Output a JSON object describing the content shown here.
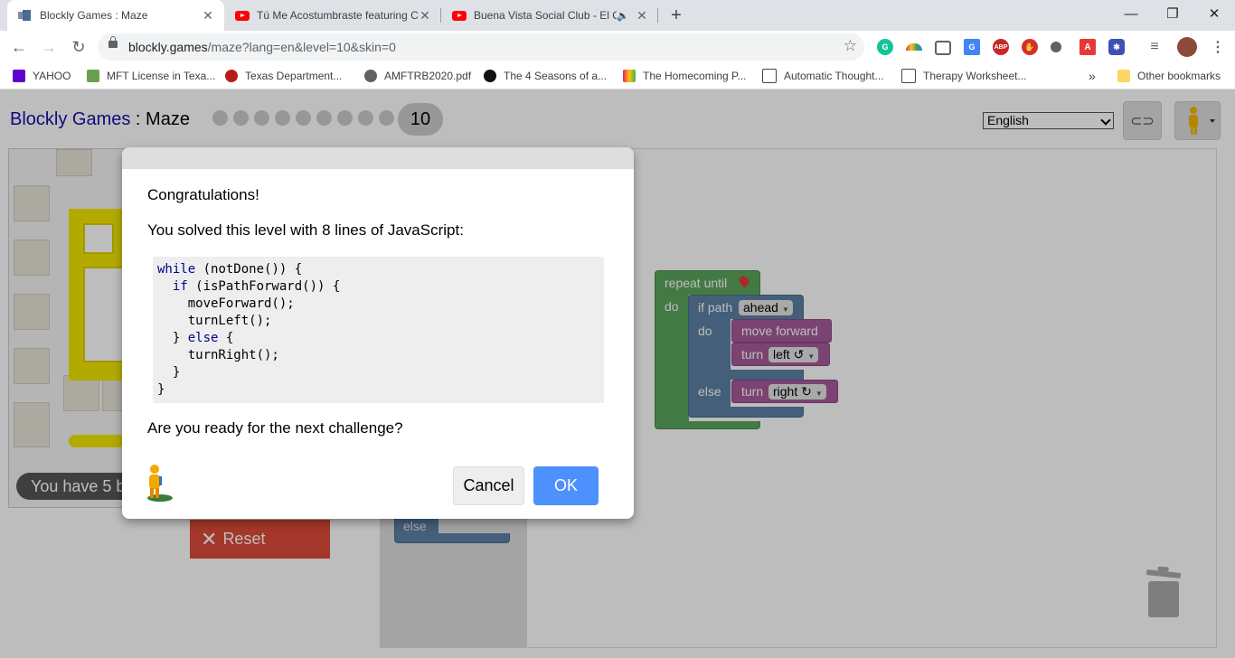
{
  "browser": {
    "tabs": [
      {
        "title": "Blockly Games : Maze",
        "active": true
      },
      {
        "title": "Tú Me Acostumbraste featuring C",
        "active": false
      },
      {
        "title": "Buena Vista Social Club - El C",
        "active": false
      }
    ],
    "url_host": "blockly.games",
    "url_path": "/maze?lang=en&level=10&skin=0",
    "bookmarks": [
      "YAHOO",
      "MFT License in Texa...",
      "Texas Department...",
      "AMFTRB2020.pdf",
      "The 4 Seasons of a...",
      "The Homecoming P...",
      "Automatic Thought...",
      "Therapy Worksheet..."
    ],
    "bookmarks_overflow": "»",
    "other_bookmarks": "Other bookmarks"
  },
  "app": {
    "brand": "Blockly Games",
    "separator": " : ",
    "game": "Maze",
    "current_level": "10",
    "language": "English",
    "steps_text": "You have 5 b",
    "reset_label": "Reset"
  },
  "blocks": {
    "repeat_until": "repeat until",
    "do": "do",
    "if_path": "if path",
    "ahead": "ahead",
    "move_forward": "move forward",
    "turn": "turn",
    "left": "left ↺",
    "right": "right ↻",
    "else": "else"
  },
  "dialog": {
    "heading": "Congratulations!",
    "solved_text": "You solved this level with 8 lines of JavaScript:",
    "code_lines": [
      "while (notDone()) {",
      "  if (isPathForward()) {",
      "    moveForward();",
      "    turnLeft();",
      "  } else {",
      "    turnRight();",
      "  }",
      "}"
    ],
    "question": "Are you ready for the next challenge?",
    "cancel_label": "Cancel",
    "ok_label": "OK"
  },
  "colors": {
    "loop_block": "#5ba55b",
    "logic_block": "#5b80a5",
    "movement_block": "#a55b99",
    "reset_button": "#dd4b39",
    "ok_button": "#4d90fe"
  }
}
